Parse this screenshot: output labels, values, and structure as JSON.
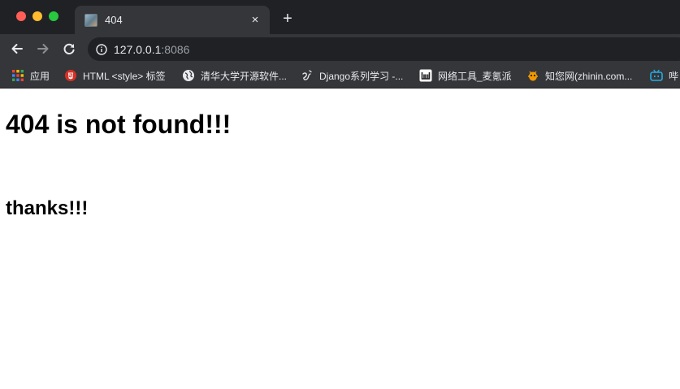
{
  "tab": {
    "title": "404",
    "close": "×"
  },
  "newtab": {
    "label": "+"
  },
  "address": {
    "host": "127.0.0.1",
    "port": ":8086"
  },
  "bookmarks": [
    {
      "label": "应用",
      "icon": "apps-grid-icon"
    },
    {
      "label": "HTML <style> 标签",
      "icon": "html5-icon"
    },
    {
      "label": "清华大学开源软件...",
      "icon": "globe-icon"
    },
    {
      "label": "Django系列学习 -...",
      "icon": "om-icon"
    },
    {
      "label": "网络工具_麦氪派",
      "icon": "w-logo-icon"
    },
    {
      "label": "知您网(zhinin.com...",
      "icon": "bug-icon"
    },
    {
      "label": "哔",
      "icon": "bilibili-tv-icon"
    }
  ],
  "page": {
    "heading": "404 is not found!!!",
    "subheading": "thanks!!!"
  },
  "colors": {
    "titlebar": "#202124",
    "toolbar": "#35363a",
    "text_light": "#e8eaed",
    "page_bg": "#ffffff"
  }
}
